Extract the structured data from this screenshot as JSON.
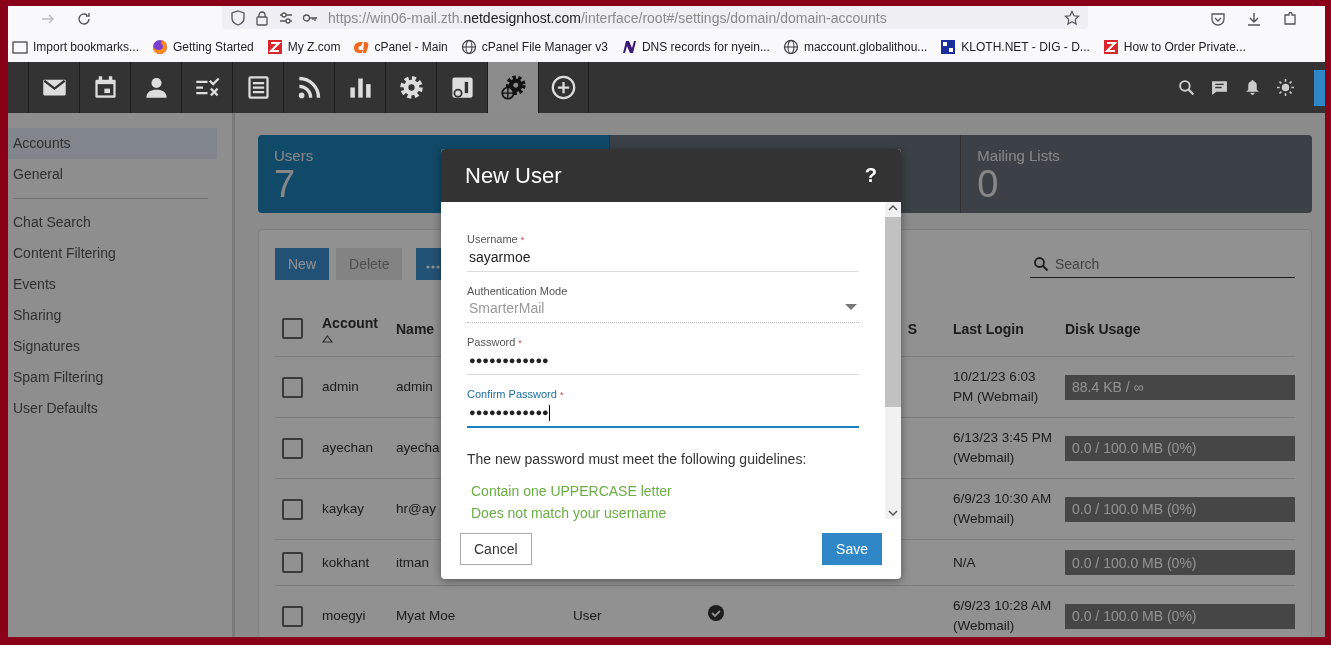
{
  "browser": {
    "url": "https://win06-mail.zth.**netdesignhost.com**/interface/root#/settings/domain/domain-accounts",
    "bookmarks": [
      {
        "label": "Import bookmarks..."
      },
      {
        "label": "Getting Started"
      },
      {
        "label": "My Z.com"
      },
      {
        "label": "cPanel - Main"
      },
      {
        "label": "cPanel File Manager v3"
      },
      {
        "label": "DNS records for nyein..."
      },
      {
        "label": "maccount.globalithou..."
      },
      {
        "label": "KLOTH.NET - DIG - D..."
      },
      {
        "label": "How to Order Private..."
      }
    ]
  },
  "nav": [
    {
      "selected": false
    },
    {
      "selected": false
    },
    {
      "selected": false
    },
    {
      "selected": false
    },
    {
      "selected": false
    },
    {
      "selected": false
    },
    {
      "selected": false
    },
    {
      "selected": false
    },
    {
      "selected": false
    },
    {
      "selected": true
    },
    {
      "selected": false
    }
  ],
  "sidebar": {
    "items": [
      {
        "label": "Accounts",
        "selected": true
      },
      {
        "label": "General",
        "selected": false
      },
      {
        "label": "Chat Search",
        "selected": false
      },
      {
        "label": "Content Filtering",
        "selected": false
      },
      {
        "label": "Events",
        "selected": false
      },
      {
        "label": "Sharing",
        "selected": false
      },
      {
        "label": "Signatures",
        "selected": false
      },
      {
        "label": "Spam Filtering",
        "selected": false
      },
      {
        "label": "User Defaults",
        "selected": false
      }
    ]
  },
  "stats": [
    {
      "label": "Users",
      "count": "7",
      "selected": true
    },
    {
      "selected": false
    },
    {
      "label": "Mailing Lists",
      "count": "0",
      "selected": false
    }
  ],
  "toolbar": {
    "buttons": [
      {
        "label": "New",
        "disabled": false
      },
      {
        "label": "Delete",
        "disabled": true
      }
    ],
    "search": {
      "placeholder": "Search"
    }
  },
  "table": {
    "select_all_checked": false,
    "columns": {
      "account": {
        "label": "Account",
        "sorted": true
      },
      "name": {
        "label": "Name"
      },
      "column_5": {
        "label": "S"
      },
      "last_login": {
        "label": "Last Login"
      },
      "disk_usage": {
        "label": "Disk Usage"
      }
    },
    "rows": [
      {
        "checked": false,
        "account": "admin",
        "name": "admin",
        "last_login": "10/21/23 6:03 PM (Webmail)",
        "disk_usage": "88.4 KB / ∞"
      },
      {
        "checked": false,
        "account": "ayechan",
        "name": "ayecha",
        "last_login": "6/13/23 3:45 PM (Webmail)",
        "disk_usage": "0.0 / 100.0 MB (0%)"
      },
      {
        "checked": false,
        "account": "kaykay",
        "name": "hr@ay",
        "last_login": "6/9/23 10:30 AM (Webmail)",
        "disk_usage": "0.0 / 100.0 MB (0%)"
      },
      {
        "checked": false,
        "account": "kokhant",
        "name": "itman",
        "last_login": "N/A",
        "disk_usage": "0.0 / 100.0 MB (0%)"
      },
      {
        "checked": false,
        "account": "moegyi",
        "name": "Myat Moe",
        "column_3": "User",
        "column_4_check": true,
        "last_login": "6/9/23 10:28 AM (Webmail)",
        "disk_usage": "0.0 / 100.0 MB (0%)"
      }
    ]
  },
  "dialog": {
    "title": "New User",
    "help": "?",
    "fields": [
      {
        "kind": "text",
        "label": "Username",
        "required_mark": "*",
        "value": "sayarmoe",
        "focused": false,
        "disabled": false
      },
      {
        "kind": "select",
        "label": "Authentication Mode",
        "value": "SmarterMail",
        "focused": false,
        "disabled": true
      },
      {
        "kind": "password",
        "label": "Password",
        "required_mark": "*",
        "value": "●●●●●●●●●●●●",
        "focused": false,
        "disabled": false
      },
      {
        "kind": "password",
        "label": "Confirm Password",
        "required_mark": "*",
        "value": "●●●●●●●●●●●●",
        "focused": true,
        "disabled": false
      }
    ],
    "guidelines": "The new password must meet the following guidelines:",
    "rules": [
      {
        "text": "Contain one UPPERCASE letter",
        "met": true
      },
      {
        "text": "Does not match your username",
        "met": true
      }
    ],
    "buttons": {
      "cancel": "Cancel",
      "save": "Save"
    }
  }
}
